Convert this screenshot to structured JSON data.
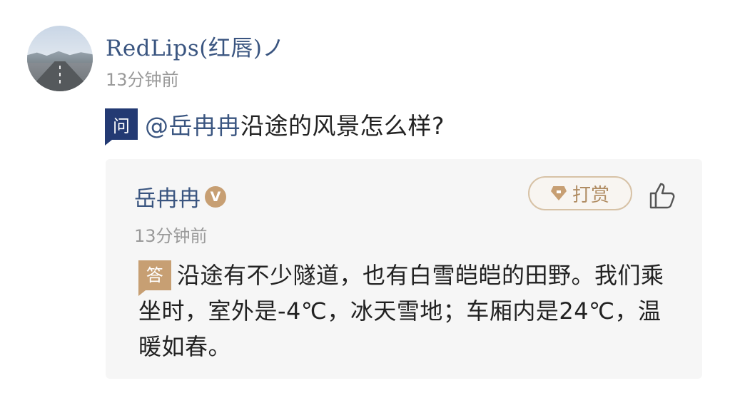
{
  "post": {
    "username": "RedLips(红唇)ノ",
    "time": "13分钟前",
    "question_badge": "问",
    "mention": "@岳冉冉",
    "question_text": "沿途的风景怎么样?"
  },
  "reply": {
    "name": "岳冉冉",
    "verified_badge": "V",
    "tip_label": "打赏",
    "time": "13分钟前",
    "answer_badge": "答",
    "answer_text": "沿途有不少隧道，也有白雪皑皑的田野。我们乘坐时，室外是-4℃，冰天雪地；车厢内是24℃，温暖如春。"
  },
  "colors": {
    "name_blue": "#3a5580",
    "question_badge": "#233a73",
    "gold": "#c79f73",
    "muted": "#9a9a9a"
  },
  "icons": [
    "avatar-road-image",
    "verified-v-icon",
    "gem-icon",
    "thumbs-up-icon"
  ]
}
